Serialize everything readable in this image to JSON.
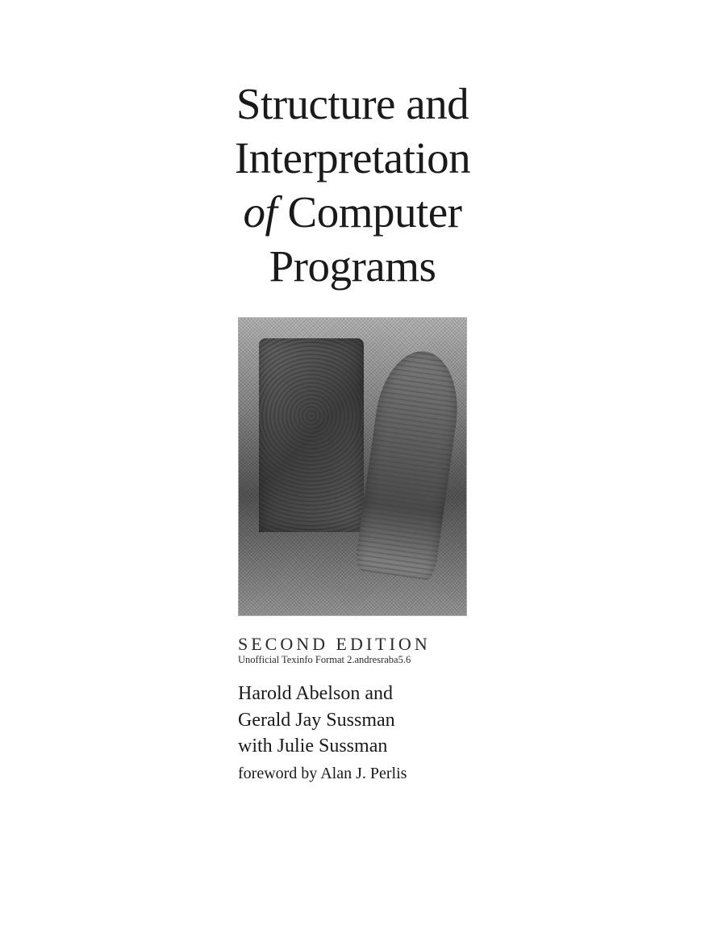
{
  "title": {
    "line1": "Structure and",
    "line2": "Interpretation",
    "line3_of": "of",
    "line3_rest": " Computer",
    "line4": "Programs"
  },
  "edition": "SECOND EDITION",
  "format_note": "Unofficial Texinfo Format 2.andresraba5.6",
  "authors": {
    "line1": "Harold Abelson and",
    "line2": "Gerald Jay Sussman",
    "line3": "with Julie Sussman"
  },
  "foreword": "foreword by Alan J. Perlis"
}
